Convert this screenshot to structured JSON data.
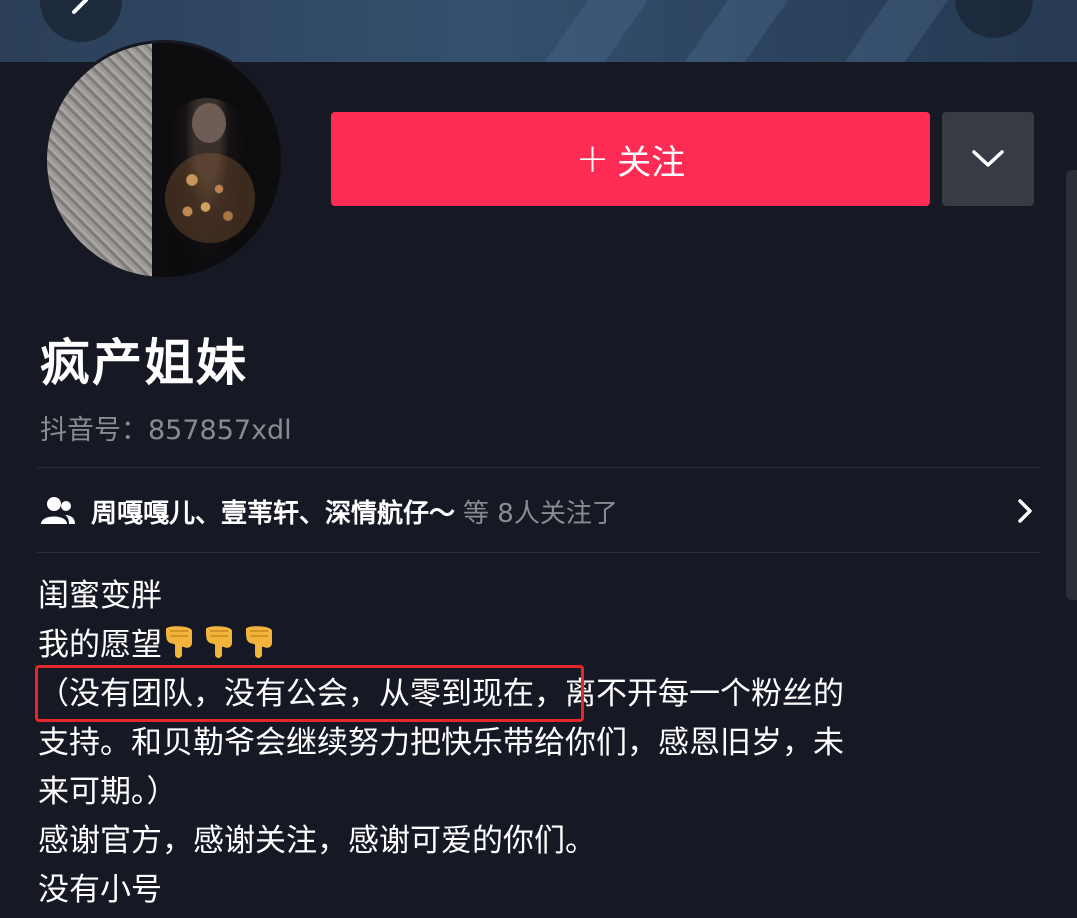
{
  "header": {
    "back_icon": "chevron-left-icon"
  },
  "profile": {
    "name": "疯产姐妹",
    "douyin_id": "抖音号：857857xdl"
  },
  "actions": {
    "follow_plus": "+",
    "follow_label": "关注",
    "dropdown_icon": "chevron-down-icon"
  },
  "followers": {
    "names": "周嘎嘎儿、壹苇轩、深情航仔～",
    "count_text": "等 8人关注了"
  },
  "bio": {
    "line1": "闺蜜变胖",
    "line2": "我的愿望",
    "line3_highlight": "（没有团队，没有公会，从零到现在",
    "line3_rest": "，离不开每一个粉丝的",
    "line4": "支持。和贝勒爷会继续努力把快乐带给你们，感恩旧岁，未",
    "line5": "来可期。）",
    "line6": "感谢官方，感谢关注，感谢可爱的你们。",
    "line7": "没有小号"
  },
  "colors": {
    "background": "#161823",
    "accent": "#fe2c55",
    "secondary_button": "#393b44",
    "muted_text": "#8a8b91",
    "highlight_border": "#e6262d"
  }
}
